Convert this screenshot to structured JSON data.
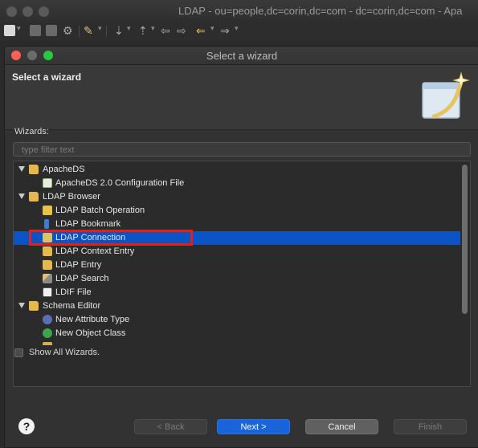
{
  "main_window": {
    "title": "LDAP - ou=people,dc=corin,dc=com - dc=corin,dc=com - Apa"
  },
  "dialog": {
    "title": "Select a wizard",
    "banner_title": "Select a wizard",
    "wizards_label": "Wizards:",
    "filter": {
      "placeholder": "type filter text",
      "value": ""
    },
    "tree": {
      "rows": [
        {
          "label": "ApacheDS",
          "level": 0,
          "expanded": true,
          "icon": "folder-icon"
        },
        {
          "label": "ApacheDS 2.0 Configuration File",
          "level": 1,
          "icon": "config-file-icon"
        },
        {
          "label": "LDAP Browser",
          "level": 0,
          "expanded": true,
          "icon": "folder-icon"
        },
        {
          "label": "LDAP Batch Operation",
          "level": 1,
          "icon": "batch-operation-icon"
        },
        {
          "label": "LDAP Bookmark",
          "level": 1,
          "icon": "bookmark-icon"
        },
        {
          "label": "LDAP Connection",
          "level": 1,
          "icon": "connection-icon",
          "selected": true
        },
        {
          "label": "LDAP Context Entry",
          "level": 1,
          "icon": "context-entry-icon"
        },
        {
          "label": "LDAP Entry",
          "level": 1,
          "icon": "entry-icon"
        },
        {
          "label": "LDAP Search",
          "level": 1,
          "icon": "search-wand-icon"
        },
        {
          "label": "LDIF File",
          "level": 1,
          "icon": "ldif-file-icon"
        },
        {
          "label": "Schema Editor",
          "level": 0,
          "expanded": true,
          "icon": "folder-icon"
        },
        {
          "label": "New Attribute Type",
          "level": 1,
          "icon": "attribute-type-icon"
        },
        {
          "label": "New Object Class",
          "level": 1,
          "icon": "object-class-icon"
        }
      ]
    },
    "show_all_wizards": {
      "label": "Show All Wizards.",
      "checked": false
    },
    "buttons": {
      "back": "< Back",
      "next": "Next >",
      "cancel": "Cancel",
      "finish": "Finish"
    },
    "help_glyph": "?"
  },
  "colors": {
    "selection": "#0a54c6",
    "primary_button": "#1864d8",
    "highlight_box": "#e0201a"
  }
}
